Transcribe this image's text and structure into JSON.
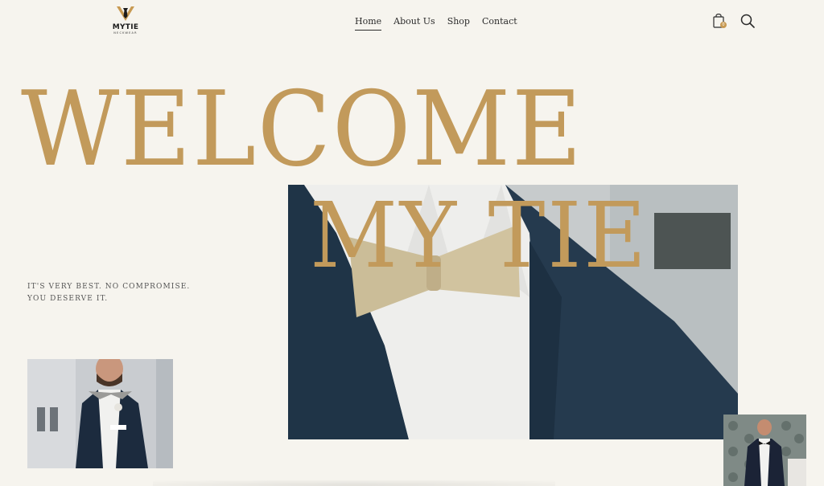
{
  "brand": {
    "name": "MYTIE",
    "subtitle": "NECKWEAR"
  },
  "nav": {
    "items": [
      "Home",
      "About Us",
      "Shop",
      "Contact"
    ],
    "active": "Home"
  },
  "cart": {
    "count": "0"
  },
  "hero": {
    "headline": "WELCOME",
    "overlay": "MY TIE",
    "tagline_line1": "IT'S VERY BEST. NO COMPROMISE.",
    "tagline_line2": "YOU DESERVE IT."
  },
  "colors": {
    "accent": "#c29a5b",
    "background": "#f6f4ee",
    "text": "#2b2b2b"
  },
  "icons": {
    "cart": "shopping-bag-icon",
    "search": "search-icon",
    "logo": "tie-logo-icon"
  }
}
